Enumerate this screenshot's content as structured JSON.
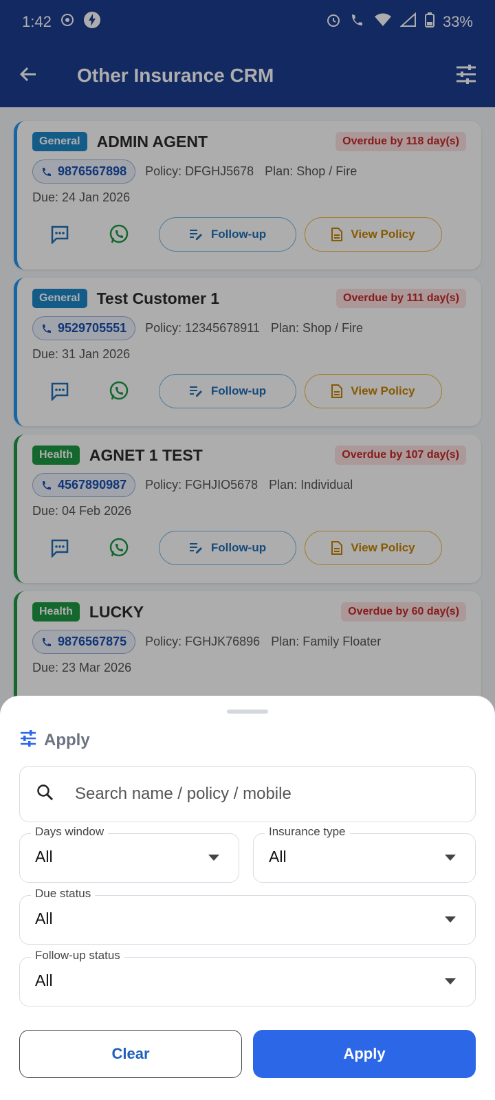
{
  "status_bar": {
    "time": "1:42",
    "battery": "33%"
  },
  "app_bar": {
    "title": "Other Insurance CRM",
    "back_icon": "arrow-left-icon",
    "filter_icon": "tune-icon"
  },
  "cards": [
    {
      "type": "General",
      "name": "ADMIN AGENT",
      "overdue": "Overdue by 118 day(s)",
      "phone": "9876567898",
      "policy": "Policy: DFGHJ5678",
      "plan": "Plan: Shop / Fire",
      "due": "Due: 24 Jan 2026",
      "followup_label": "Follow-up",
      "view_label": "View Policy"
    },
    {
      "type": "General",
      "name": "Test Customer 1",
      "overdue": "Overdue by 111 day(s)",
      "phone": "9529705551",
      "policy": "Policy: 12345678911",
      "plan": "Plan: Shop / Fire",
      "due": "Due: 31 Jan 2026",
      "followup_label": "Follow-up",
      "view_label": "View Policy"
    },
    {
      "type": "Health",
      "name": "AGNET 1 TEST",
      "overdue": "Overdue by 107 day(s)",
      "phone": "4567890987",
      "policy": "Policy: FGHJIO5678",
      "plan": "Plan: Individual",
      "due": "Due: 04 Feb 2026",
      "followup_label": "Follow-up",
      "view_label": "View Policy"
    },
    {
      "type": "Health",
      "name": "LUCKY",
      "overdue": "Overdue by 60 day(s)",
      "phone": "9876567875",
      "policy": "Policy: FGHJK76896",
      "plan": "Plan: Family Floater",
      "due": "Due: 23 Mar 2026"
    }
  ],
  "sheet": {
    "title": "Apply",
    "search_placeholder": "Search name / policy / mobile",
    "filters": {
      "days_window": {
        "label": "Days window",
        "value": "All"
      },
      "insurance_type": {
        "label": "Insurance type",
        "value": "All"
      },
      "due_status": {
        "label": "Due status",
        "value": "All"
      },
      "followup_status": {
        "label": "Follow-up status",
        "value": "All"
      }
    },
    "clear_label": "Clear",
    "apply_label": "Apply"
  },
  "colors": {
    "primary": "#1c3d8f",
    "accent": "#2c67e8",
    "health": "#1e9a45",
    "general": "#1e88c9",
    "overdue": "#c62828"
  }
}
